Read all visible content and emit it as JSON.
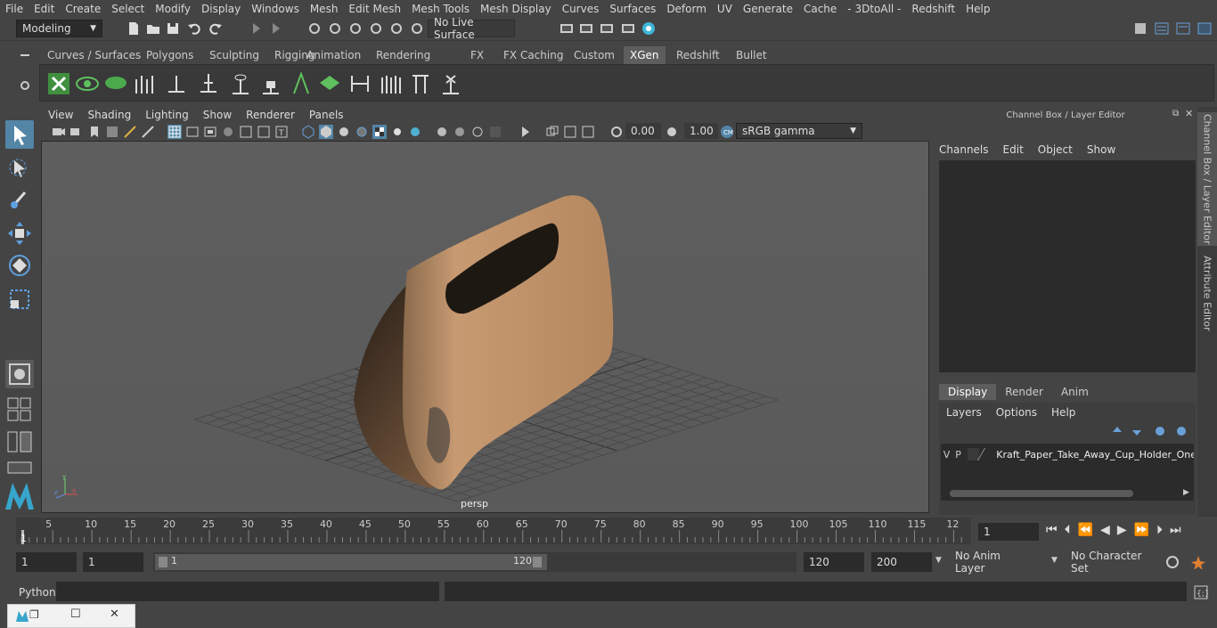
{
  "menu": [
    "File",
    "Edit",
    "Create",
    "Select",
    "Modify",
    "Display",
    "Windows",
    "Mesh",
    "Edit Mesh",
    "Mesh Tools",
    "Mesh Display",
    "Curves",
    "Surfaces",
    "Deform",
    "UV",
    "Generate",
    "Cache",
    "- 3DtoAll -",
    "Redshift",
    "Help"
  ],
  "status": {
    "mode": "Modeling",
    "live_surface": "No Live Surface"
  },
  "shelf_tabs": [
    "Curves / Surfaces",
    "Polygons",
    "Sculpting",
    "Rigging",
    "Animation",
    "Rendering",
    "FX",
    "FX Caching",
    "Custom",
    "XGen",
    "Redshift",
    "Bullet"
  ],
  "active_shelf": "XGen",
  "viewport": {
    "menus": [
      "View",
      "Shading",
      "Lighting",
      "Show",
      "Renderer",
      "Panels"
    ],
    "exposure": "0.00",
    "gamma": "1.00",
    "color_space": "sRGB gamma",
    "camera_label": "persp"
  },
  "channel_box": {
    "title": "Channel Box / Layer Editor",
    "menus": [
      "Channels",
      "Edit",
      "Object",
      "Show"
    ],
    "layer_tabs": [
      "Display",
      "Render",
      "Anim"
    ],
    "active_layer_tab": "Display",
    "layer_menus": [
      "Layers",
      "Options",
      "Help"
    ],
    "layer": {
      "v": "V",
      "p": "P",
      "name": "Kraft_Paper_Take_Away_Cup_Holder_One_C"
    }
  },
  "side_tabs": [
    "Channel Box / Layer Editor",
    "Attribute Editor"
  ],
  "timeline": {
    "ticks": [
      "5",
      "10",
      "15",
      "20",
      "25",
      "30",
      "35",
      "40",
      "45",
      "50",
      "55",
      "60",
      "65",
      "70",
      "75",
      "80",
      "85",
      "90",
      "95",
      "100",
      "105",
      "110",
      "115",
      "12"
    ],
    "start_marker": "1",
    "current_frame": "1"
  },
  "range": {
    "start": "1",
    "playback_start": "1",
    "slider_start": "1",
    "slider_end": "120",
    "playback_end": "120",
    "end": "200",
    "anim_layer": "No Anim Layer",
    "character_set": "No Character Set"
  },
  "command": {
    "label": "Python"
  },
  "colors": {
    "accent": "#5285a6",
    "object": "#c4946a",
    "active_tab": "#5d5d5d"
  }
}
